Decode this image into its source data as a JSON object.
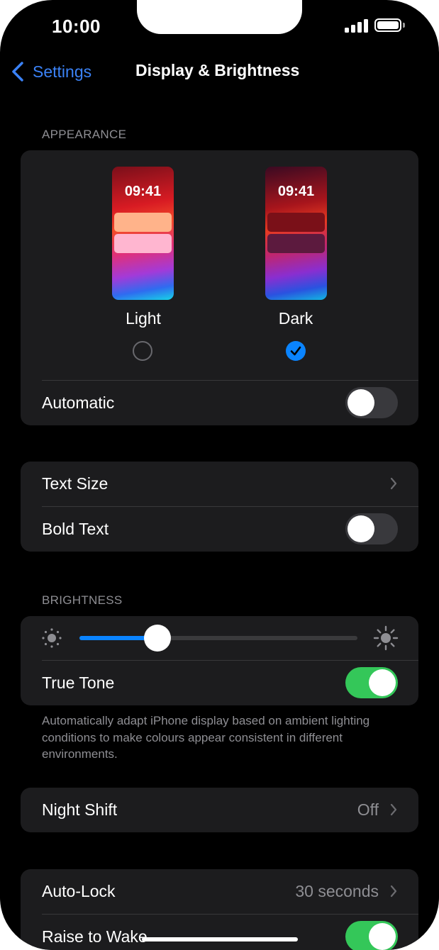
{
  "status_bar": {
    "time": "10:00"
  },
  "nav": {
    "back_label": "Settings",
    "title": "Display & Brightness"
  },
  "appearance": {
    "header": "APPEARANCE",
    "light": {
      "preview_time": "09:41",
      "label": "Light",
      "selected": false
    },
    "dark": {
      "preview_time": "09:41",
      "label": "Dark",
      "selected": true
    },
    "automatic_label": "Automatic",
    "automatic_on": false
  },
  "text": {
    "text_size_label": "Text Size",
    "bold_text_label": "Bold Text",
    "bold_text_on": false
  },
  "brightness": {
    "header": "BRIGHTNESS",
    "level_fraction": 0.28,
    "true_tone_label": "True Tone",
    "true_tone_on": true,
    "footnote": "Automatically adapt iPhone display based on ambient lighting conditions to make colours appear consistent in different environments."
  },
  "night_shift": {
    "label": "Night Shift",
    "value": "Off"
  },
  "lock": {
    "auto_lock_label": "Auto-Lock",
    "auto_lock_value": "30 seconds",
    "raise_to_wake_label": "Raise to Wake",
    "raise_to_wake_on": true
  },
  "colors": {
    "accent": "#0a84ff",
    "toggle_on": "#34c759",
    "card": "#1c1c1e",
    "background": "#000000"
  }
}
